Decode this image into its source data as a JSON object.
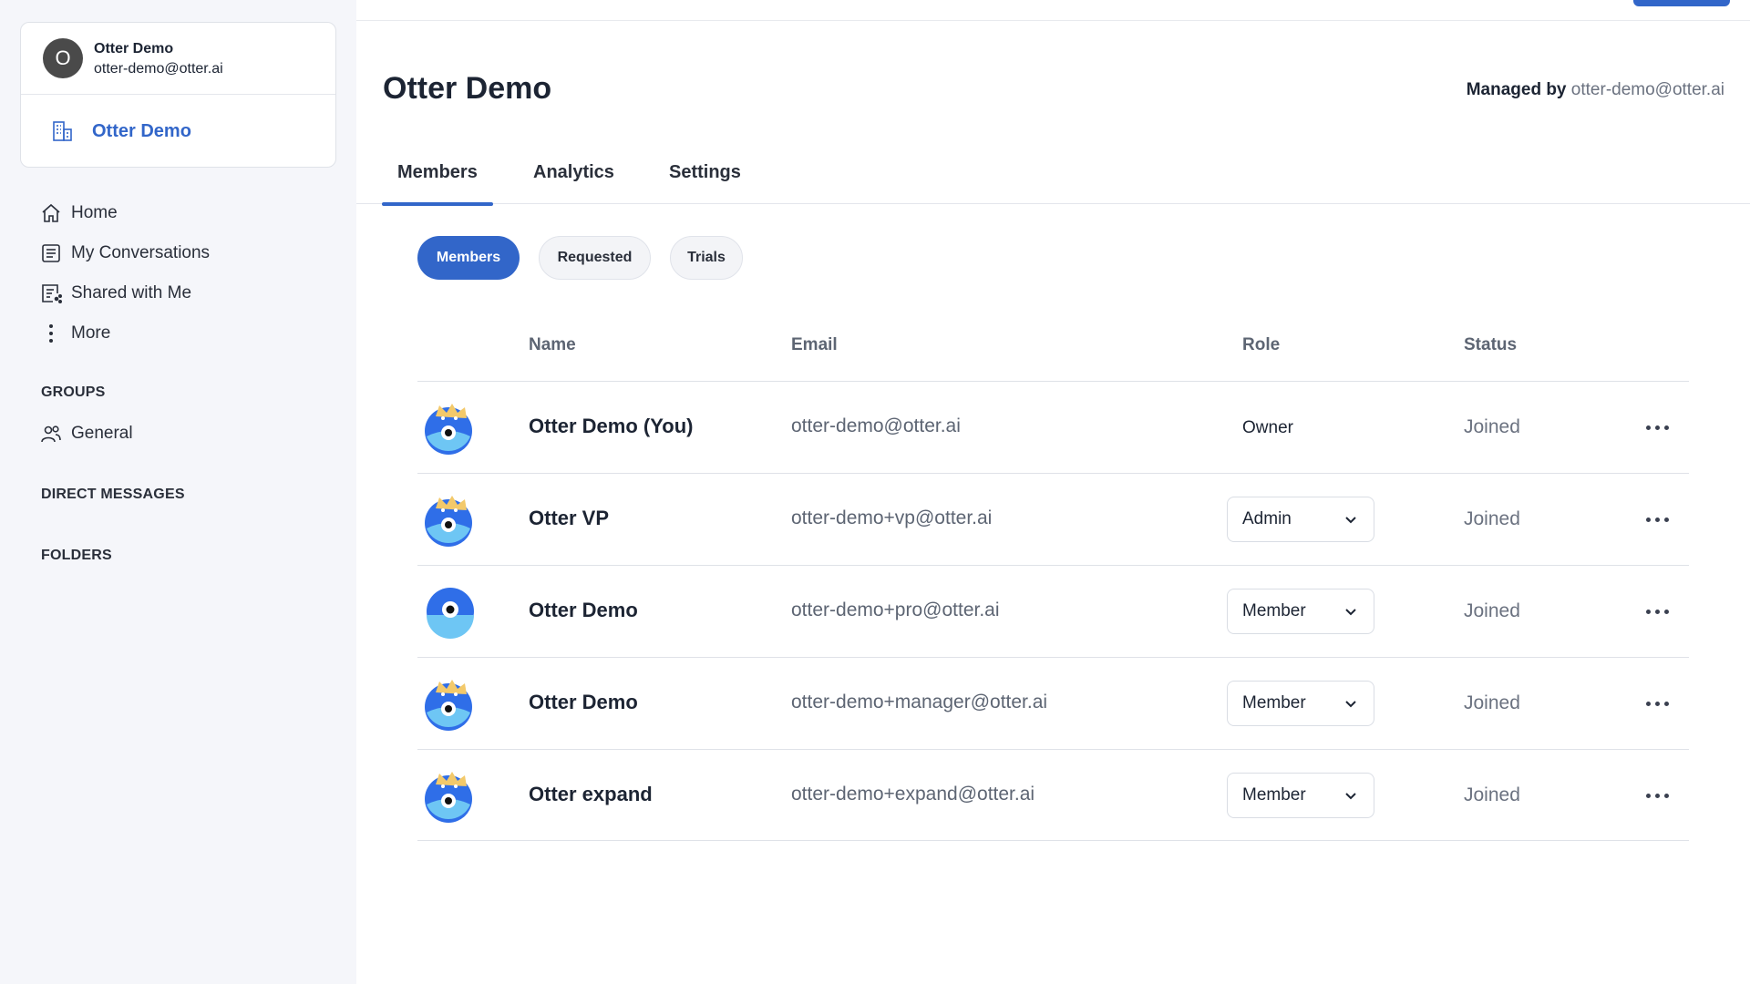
{
  "account": {
    "initial": "O",
    "name": "Otter Demo",
    "email": "otter-demo@otter.ai"
  },
  "workspace": {
    "label": "Otter Demo"
  },
  "nav": [
    {
      "label": "Home",
      "icon": "home-icon"
    },
    {
      "label": "My Conversations",
      "icon": "conversations-icon"
    },
    {
      "label": "Shared with Me",
      "icon": "shared-icon"
    },
    {
      "label": "More",
      "icon": "more-vertical-icon"
    }
  ],
  "sections": {
    "groups": "GROUPS",
    "direct_messages": "DIRECT MESSAGES",
    "folders": "FOLDERS"
  },
  "groups": [
    {
      "label": "General",
      "icon": "group-icon"
    }
  ],
  "header": {
    "title": "Otter Demo",
    "managed_label": "Managed by",
    "managed_email": "otter-demo@otter.ai"
  },
  "tabs": [
    {
      "label": "Members",
      "active": true
    },
    {
      "label": "Analytics"
    },
    {
      "label": "Settings"
    }
  ],
  "filters": [
    {
      "label": "Members",
      "active": true
    },
    {
      "label": "Requested"
    },
    {
      "label": "Trials"
    }
  ],
  "table": {
    "columns": [
      "Name",
      "Email",
      "Role",
      "Status"
    ],
    "rows": [
      {
        "name": "Otter Demo (You)",
        "email": "otter-demo@otter.ai",
        "role": "Owner",
        "role_editable": false,
        "status": "Joined",
        "avatar": "otter-crown-avatar"
      },
      {
        "name": "Otter VP",
        "email": "otter-demo+vp@otter.ai",
        "role": "Admin",
        "role_editable": true,
        "status": "Joined",
        "avatar": "otter-crown-avatar"
      },
      {
        "name": "Otter Demo",
        "email": "otter-demo+pro@otter.ai",
        "role": "Member",
        "role_editable": true,
        "status": "Joined",
        "avatar": "otter-avatar"
      },
      {
        "name": "Otter Demo",
        "email": "otter-demo+manager@otter.ai",
        "role": "Member",
        "role_editable": true,
        "status": "Joined",
        "avatar": "otter-crown-avatar"
      },
      {
        "name": "Otter expand",
        "email": "otter-demo+expand@otter.ai",
        "role": "Member",
        "role_editable": true,
        "status": "Joined",
        "avatar": "otter-crown-avatar"
      }
    ]
  },
  "colors": {
    "accent": "#3266c9",
    "sidebar_bg": "#f5f6fa",
    "text": "#1c2433",
    "muted": "#6b7280"
  }
}
